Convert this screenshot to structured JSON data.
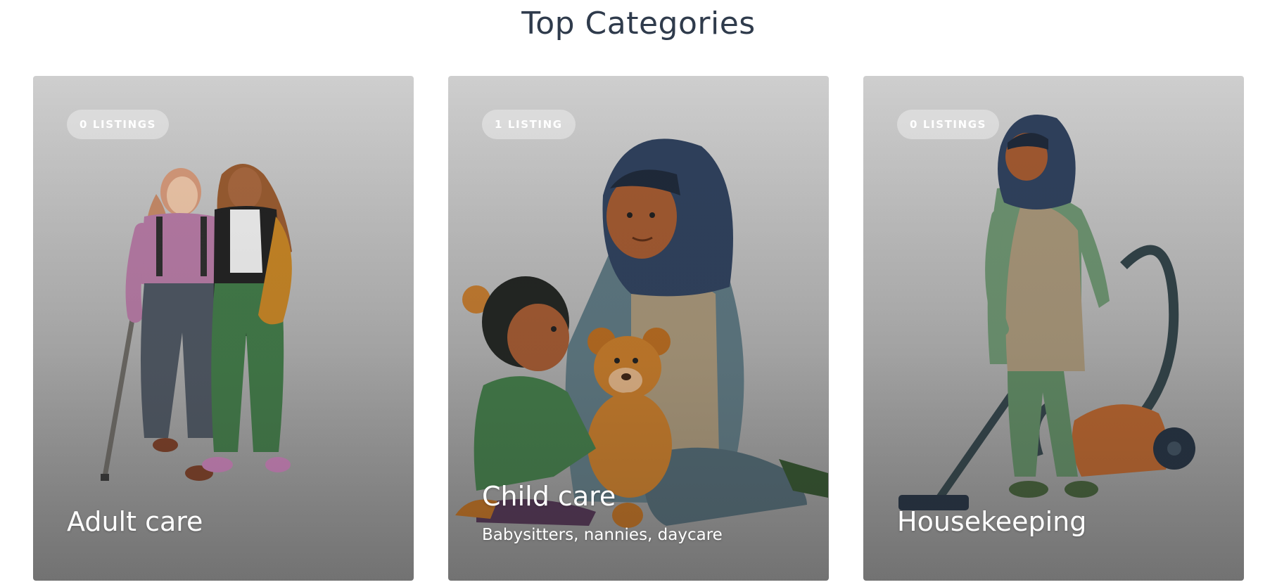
{
  "section": {
    "title": "Top Categories"
  },
  "cards": [
    {
      "badge": "0 LISTINGS",
      "title": "Adult care",
      "subtitle": ""
    },
    {
      "badge": "1 LISTING",
      "title": "Child care",
      "subtitle": "Babysitters, nannies, daycare"
    },
    {
      "badge": "0 LISTINGS",
      "title": "Housekeeping",
      "subtitle": ""
    }
  ],
  "colors": {
    "title_text": "#2f3b4c",
    "card_text": "#ffffff",
    "card_overlay_top": "#d6d6d6",
    "card_overlay_bottom": "#8b8b8b"
  },
  "icons": [
    "adult-care-illustration",
    "child-care-illustration",
    "housekeeping-illustration"
  ]
}
